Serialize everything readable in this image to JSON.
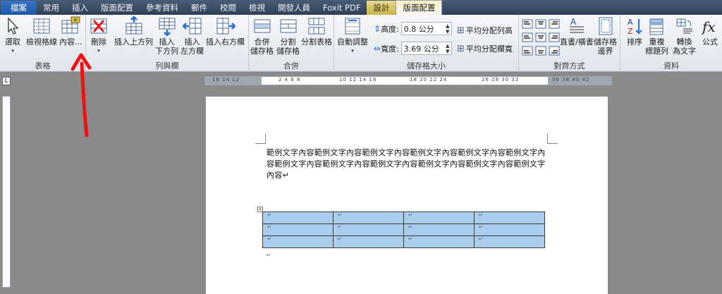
{
  "tabs": [
    "檔案",
    "常用",
    "插入",
    "版面配置",
    "參考資料",
    "郵件",
    "校閱",
    "檢視",
    "開發人員",
    "Foxit PDF",
    "設計",
    "版面配置"
  ],
  "groups": {
    "table": {
      "label": "表格",
      "select": "選取",
      "gridlines": "檢視格線",
      "properties": "內容..."
    },
    "rows_cols": {
      "label": "列與欄",
      "delete": "刪除",
      "insert_above": "插入上方列",
      "insert_below": "插入\n下方列",
      "insert_left": "插入\n左方欄",
      "insert_right": "插入右方欄"
    },
    "merge": {
      "label": "合併",
      "merge_cells": "合併\n儲存格",
      "split_cells": "分割\n儲存格",
      "split_table": "分割表格"
    },
    "cell_size": {
      "label": "儲存格大小",
      "autofit": "自動調整",
      "height_label": "高度:",
      "height_value": "0.8 公分",
      "width_label": "寬度:",
      "width_value": "3.69 公分",
      "dist_rows": "平均分配列高",
      "dist_cols": "平均分配欄寬"
    },
    "alignment": {
      "label": "對齊方式",
      "text_direction": "直書/橫書",
      "cell_margins": "儲存格\n邊界"
    },
    "data": {
      "label": "資料",
      "sort": "排序",
      "repeat_header": "重複\n標題列",
      "convert": "轉換\n為文字",
      "formula": "公式"
    }
  },
  "ruler": {
    "h_left": "16 14 12",
    "h_mid": "2 4 6 8",
    "h_right1": "10 12 14 16",
    "h_right2": "18 20 22 24",
    "h_right3": "26 28 30 32",
    "h_right4": "36 38 40 42",
    "corner": "L"
  },
  "document": {
    "paragraph": "範例文字內容範例文字內容範例文字內容範例文字內容範例文字內容範例文字內容範例文字內容範例文字內容範例文字內容範例文字內容範例文字內容範例文字內容↵",
    "cell_mark": "↵",
    "table_rows": 3,
    "table_cols": 4
  },
  "colors": {
    "table_fill": "#a9cdee",
    "annotation_arrow": "#ee1111"
  }
}
